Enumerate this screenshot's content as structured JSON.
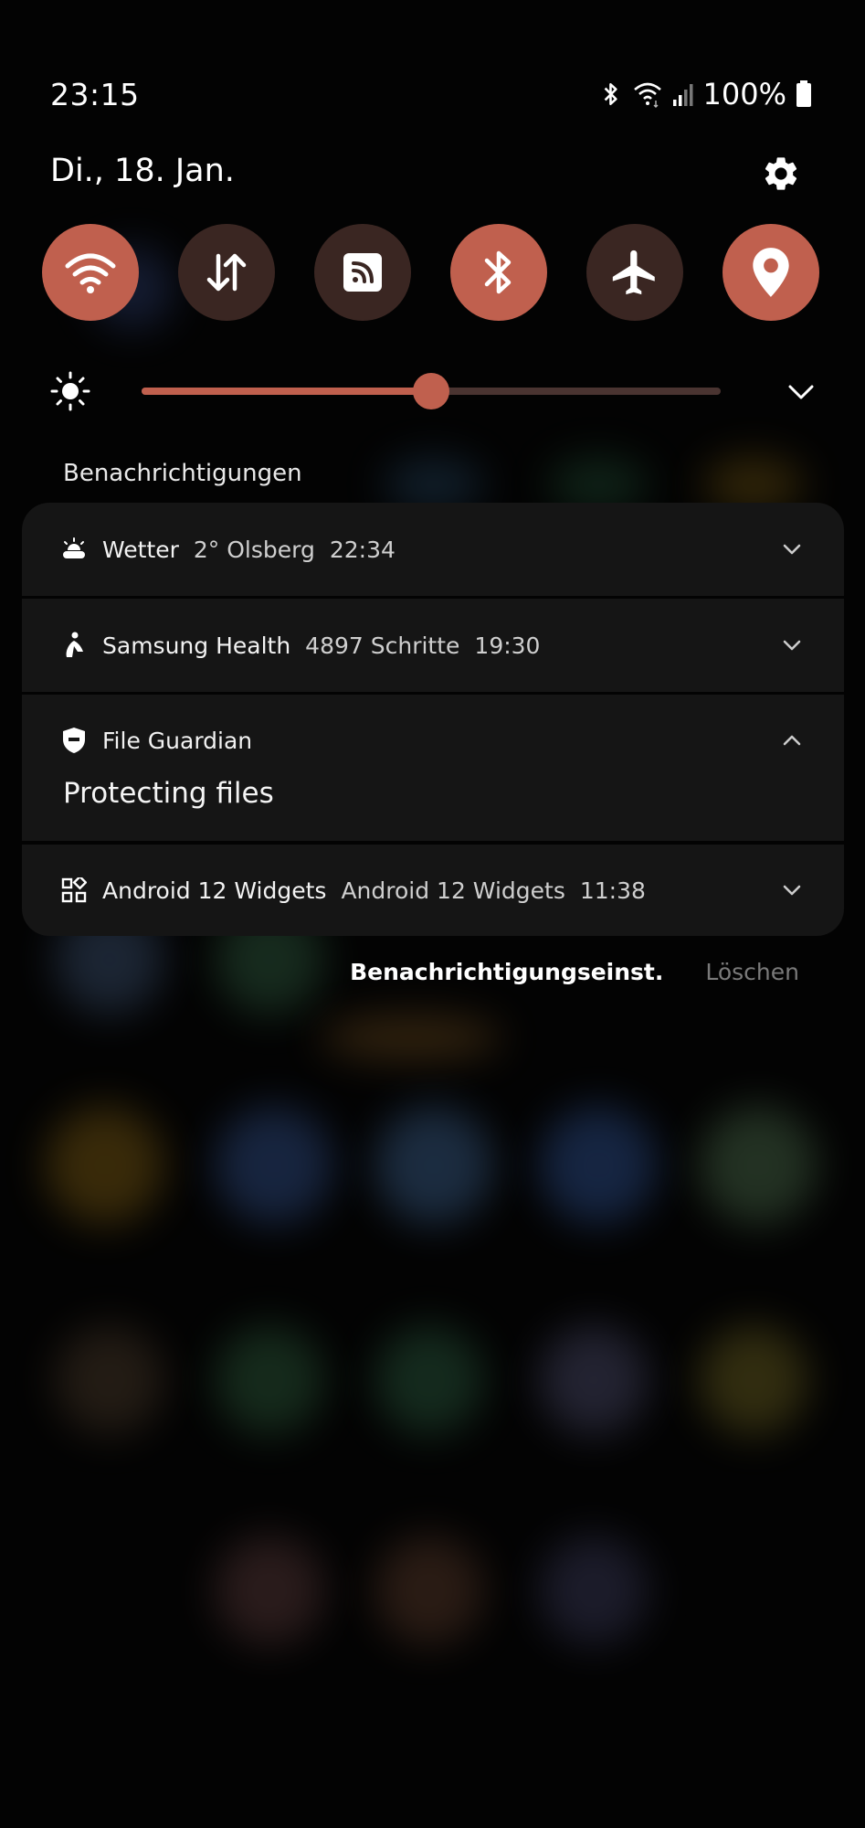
{
  "status_bar": {
    "time": "23:15",
    "battery": "100%"
  },
  "header": {
    "date": "Di., 18. Jan."
  },
  "quick_settings": [
    {
      "name": "wifi",
      "icon": "wifi-icon",
      "active": true
    },
    {
      "name": "mobile-data",
      "icon": "data-arrows-icon",
      "active": false
    },
    {
      "name": "nfc",
      "icon": "nfc-icon",
      "active": false
    },
    {
      "name": "bluetooth",
      "icon": "bluetooth-icon",
      "active": true
    },
    {
      "name": "airplane-mode",
      "icon": "airplane-icon",
      "active": false
    },
    {
      "name": "location",
      "icon": "location-pin-icon",
      "active": true
    }
  ],
  "brightness": {
    "level": 0.5
  },
  "notifications": {
    "section_title": "Benachrichtigungen",
    "items": [
      {
        "app": "Wetter",
        "detail": "2° Olsberg",
        "time": "22:34",
        "icon": "weather-sun-cloud-icon",
        "expanded": false
      },
      {
        "app": "Samsung Health",
        "detail": "4897 Schritte",
        "time": "19:30",
        "icon": "walking-person-icon",
        "expanded": false
      },
      {
        "app": "File Guardian",
        "detail": "",
        "time": "",
        "icon": "shield-icon",
        "expanded": true,
        "body": "Protecting files"
      },
      {
        "app": "Android 12 Widgets",
        "detail": "Android 12 Widgets",
        "time": "11:38",
        "icon": "widgets-grid-icon",
        "expanded": false
      }
    ]
  },
  "footer": {
    "settings_label": "Benachrichtigungseinst.",
    "clear_label": "Löschen"
  },
  "colors": {
    "accent": "#c0604e",
    "tile_off": "#3a2622",
    "card": "#151515"
  }
}
